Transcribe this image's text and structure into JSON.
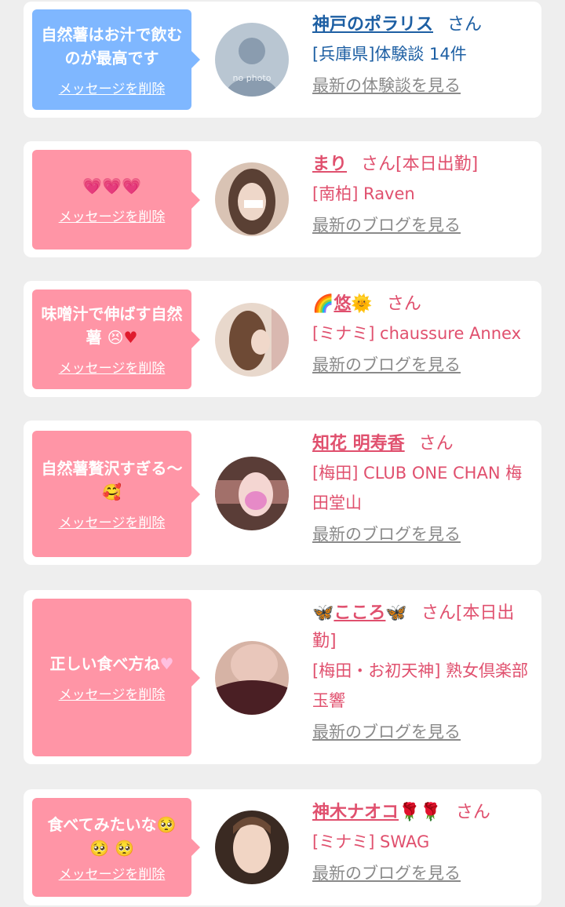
{
  "cards": [
    {
      "message": "自然薯はお汁で飲むのが最高です",
      "delete_label": "メッセージを削除",
      "name": "神戸のポラリス",
      "suffix": "さん",
      "shop": "[兵庫県]体験談 14件",
      "more_label": "最新の体験談を見る",
      "avatar_text": "no photo",
      "bubble_color": "#7fb7ff",
      "text_color": "#1d5fa3"
    },
    {
      "message": "💗💗💗",
      "delete_label": "メッセージを削除",
      "name": "まり",
      "suffix": "さん[本日出勤]",
      "shop": "[南柏] Raven",
      "more_label": "最新のブログを見る",
      "bubble_color": "#ff95a6",
      "text_color": "#e0506e"
    },
    {
      "message": "味噌汁で伸ばす自然薯",
      "delete_label": "メッセージを削除",
      "name": "悠",
      "suffix": "さん",
      "shop": "[ミナミ] chaussure Annex",
      "more_label": "最新のブログを見る",
      "bubble_color": "#ff95a6",
      "text_color": "#e0506e"
    },
    {
      "message": "自然薯贅沢すぎる〜",
      "delete_label": "メッセージを削除",
      "name": "知花 明寿香",
      "suffix": "さん",
      "shop": "[梅田] CLUB ONE CHAN 梅田堂山",
      "more_label": "最新のブログを見る",
      "bubble_color": "#ff95a6",
      "text_color": "#e0506e"
    },
    {
      "message": "正しい食べ方ね",
      "delete_label": "メッセージを削除",
      "name": "こころ",
      "suffix": "さん[本日出勤]",
      "shop": "[梅田・お初天神] 熟女倶楽部 玉響",
      "more_label": "最新のブログを見る",
      "bubble_color": "#ff95a6",
      "text_color": "#e0506e"
    },
    {
      "message": "食べてみたいな",
      "delete_label": "メッセージを削除",
      "name": "神木ナオコ",
      "suffix": "さん",
      "shop": "[ミナミ] SWAG",
      "more_label": "最新のブログを見る",
      "bubble_color": "#ff95a6",
      "text_color": "#e0506e"
    }
  ]
}
